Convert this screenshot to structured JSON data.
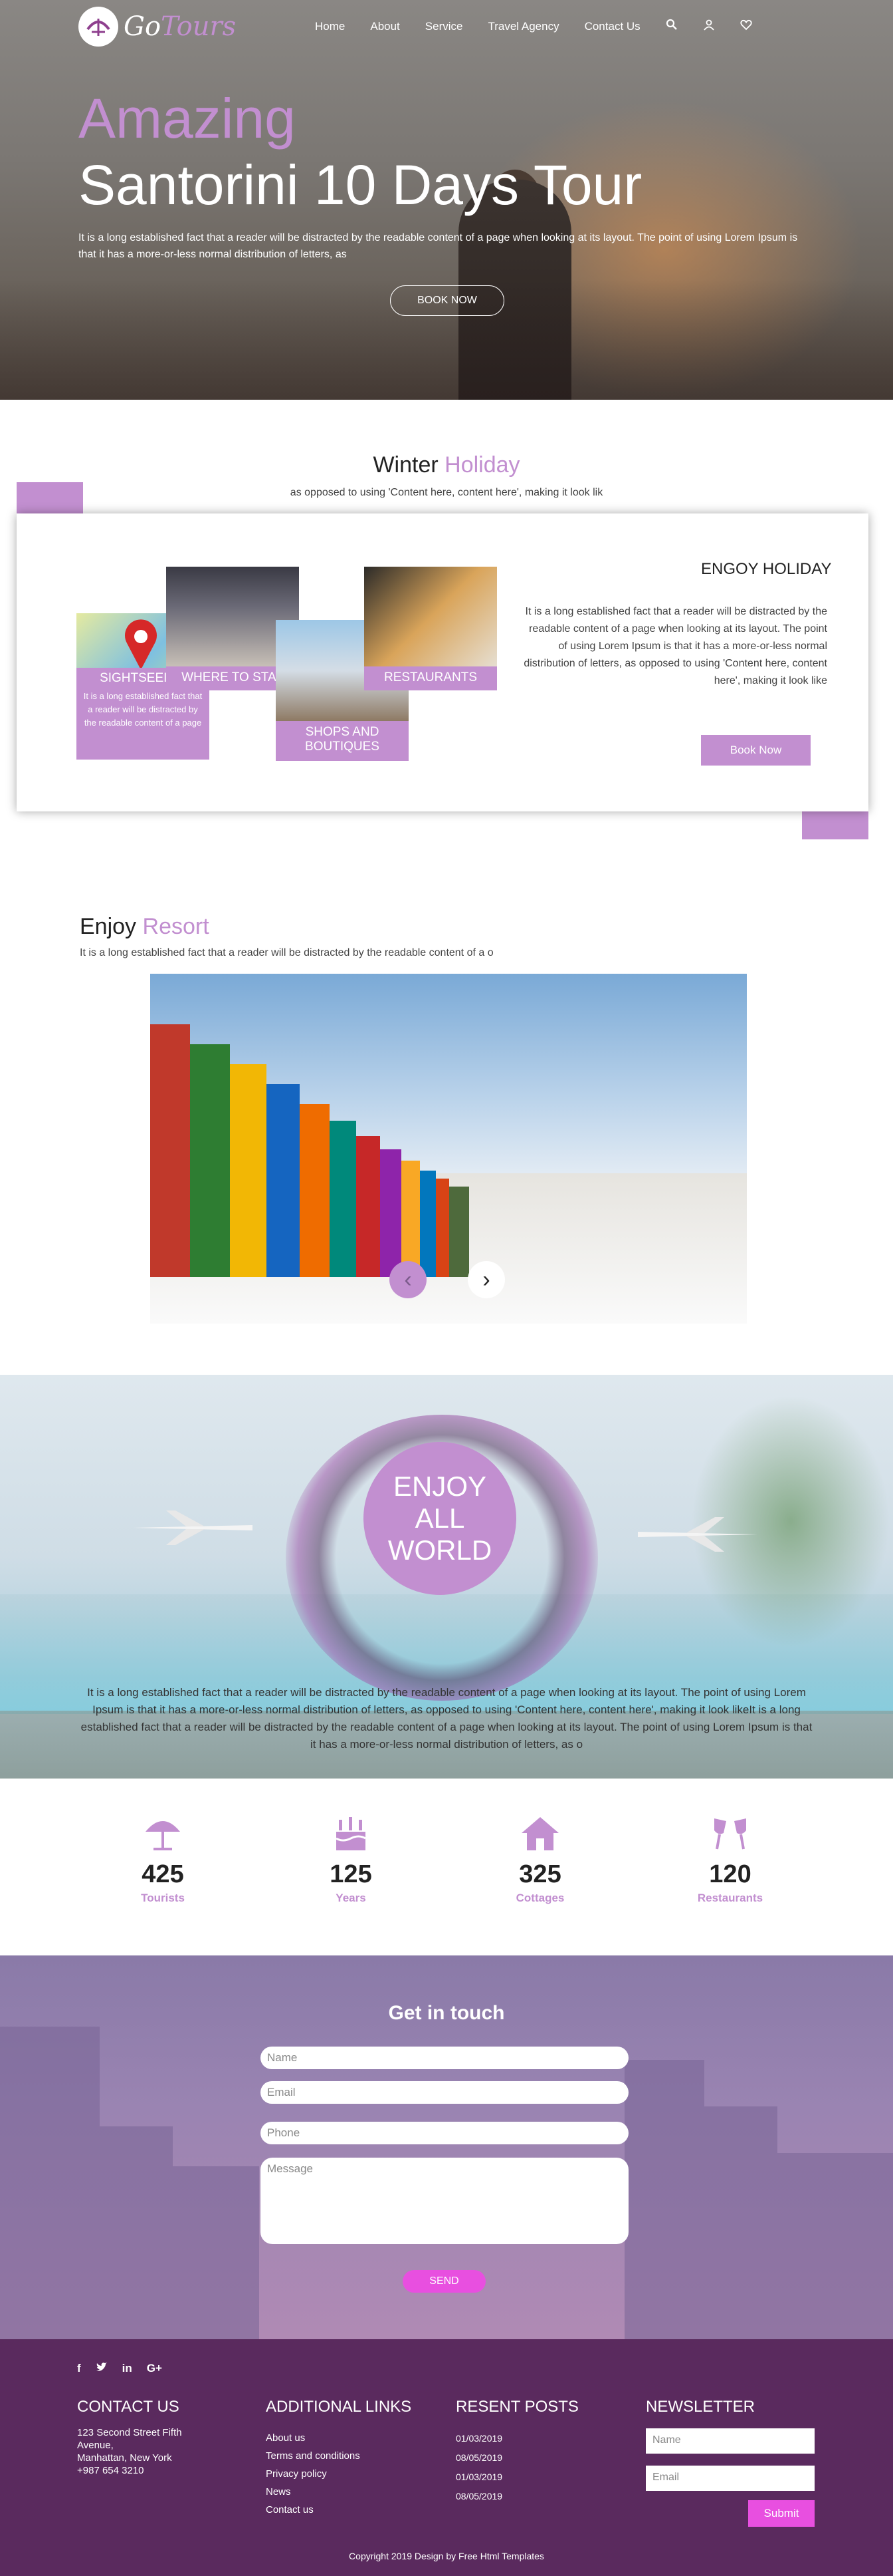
{
  "brand": {
    "name_a": "Go",
    "name_b": "Tours"
  },
  "nav": {
    "items": [
      "Home",
      "About",
      "Service",
      "Travel Agency",
      "Contact Us"
    ]
  },
  "icons": {
    "search": "search-icon",
    "user": "user-icon",
    "wishlist": "heart-icon"
  },
  "hero": {
    "title_line1": "Amazing",
    "title_line2": "Santorini 10 Days Tour",
    "text": "It is a long established fact that a reader will be distracted by the readable content of a page when looking at its layout. The point of using Lorem Ipsum is that it has a more-or-less normal distribution of letters, as",
    "button": "BOOK NOW"
  },
  "winter": {
    "title_a": "Winter",
    "title_b": "Holiday",
    "subtitle": "as opposed to using 'Content here, content here', making it look lik",
    "tiles": [
      {
        "label": "SIGHTSEEING",
        "desc": "It is a long established fact that a reader will be distracted by the readable content of a page"
      },
      {
        "label": "WHERE TO STAY"
      },
      {
        "label": "RESTAURANTS"
      },
      {
        "label": "SHOPS AND BOUTIQUES"
      }
    ],
    "heading": "ENGOY HOLIDAY",
    "text": "It is a long established fact that a reader will be distracted by the readable content of a page when looking at its layout. The point of using Lorem Ipsum is that it has a more-or-less normal distribution of letters, as opposed to using 'Content here, content here', making it look like",
    "button": "Book Now"
  },
  "resort": {
    "title_a": "Enjoy",
    "title_b": "Resort",
    "subtitle": "It is a long established fact that a reader will be distracted by the readable content of a o",
    "prev": "‹",
    "next": "›"
  },
  "world": {
    "line1": "ENJOY",
    "line2": "ALL",
    "line3": "WORLD",
    "text": "It is a long established fact that a reader will be distracted by the readable content of a page when looking at its layout. The point of using Lorem Ipsum is that it has a more-or-less normal distribution of letters, as opposed to using 'Content here, content here', making it look likeIt is a long established fact that a reader will be distracted by the readable content of a page when looking at its layout. The point of using Lorem Ipsum is that it has a more-or-less normal distribution of letters, as o"
  },
  "stats": [
    {
      "num": "425",
      "label": "Tourists",
      "icon": "umbrella-icon"
    },
    {
      "num": "125",
      "label": "Years",
      "icon": "cake-icon"
    },
    {
      "num": "325",
      "label": "Cottages",
      "icon": "house-icon"
    },
    {
      "num": "120",
      "label": "Restaurants",
      "icon": "glasses-icon"
    }
  ],
  "contact": {
    "title": "Get in touch",
    "name": "Name",
    "email": "Email",
    "phone": "Phone",
    "message": "Message",
    "send": "SEND"
  },
  "footer": {
    "contact_title": "CONTACT US",
    "address": [
      "123 Second Street Fifth",
      "Avenue,",
      "Manhattan, New York",
      "+987 654 3210"
    ],
    "links_title": "ADDITIONAL LINKS",
    "links": [
      "About us",
      "Terms and conditions",
      "Privacy policy",
      "News",
      "Contact us"
    ],
    "posts_title": "RESENT POSTS",
    "posts": [
      "01/03/2019",
      "08/05/2019",
      "01/03/2019",
      "08/05/2019"
    ],
    "newsletter_title": "NEWSLETTER",
    "nl_name": "Name",
    "nl_email": "Email",
    "submit": "Submit",
    "social": [
      "f",
      "t",
      "in",
      "G+"
    ],
    "copyright": "Copyright 2019 Design by Free Html Templates"
  },
  "colors": {
    "accent": "#c28fd0",
    "footer": "#5a2a5e",
    "pink": "#e84fe0"
  }
}
